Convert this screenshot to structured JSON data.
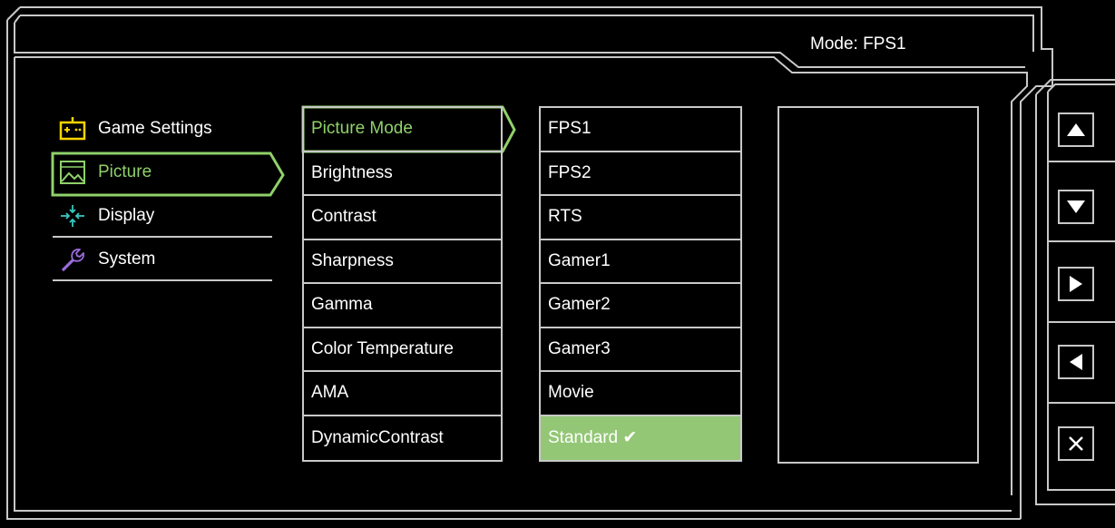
{
  "header": {
    "mode_text": "Mode: FPS1"
  },
  "main_menu": {
    "items": [
      {
        "label": "Game Settings",
        "icon": "gamepad-icon",
        "selected": false
      },
      {
        "label": "Picture",
        "icon": "picture-icon",
        "selected": true
      },
      {
        "label": "Display",
        "icon": "display-arrows-icon",
        "selected": false
      },
      {
        "label": "System",
        "icon": "wrench-icon",
        "selected": false
      }
    ]
  },
  "sub_menu": {
    "items": [
      {
        "label": "Picture Mode",
        "selected": true
      },
      {
        "label": "Brightness"
      },
      {
        "label": "Contrast"
      },
      {
        "label": "Sharpness"
      },
      {
        "label": "Gamma"
      },
      {
        "label": "Color Temperature"
      },
      {
        "label": "AMA"
      },
      {
        "label": "DynamicContrast"
      }
    ]
  },
  "options": {
    "items": [
      {
        "label": "FPS1"
      },
      {
        "label": "FPS2"
      },
      {
        "label": "RTS"
      },
      {
        "label": "Gamer1"
      },
      {
        "label": "Gamer2"
      },
      {
        "label": "Gamer3"
      },
      {
        "label": "Movie"
      },
      {
        "label": "Standard ✔",
        "selected": true
      }
    ]
  },
  "nav_buttons": [
    {
      "icon": "triangle-up-icon"
    },
    {
      "icon": "triangle-down-icon"
    },
    {
      "icon": "triangle-right-icon"
    },
    {
      "icon": "triangle-left-icon"
    },
    {
      "icon": "close-x-icon"
    }
  ],
  "colors": {
    "background": "#000000",
    "frame": "#c8c8c8",
    "accent_green": "#8fd16a",
    "selected_fill": "#93c775",
    "gamepad_yellow": "#ffd400",
    "display_teal": "#38c7c0",
    "wrench_purple": "#9b6be0"
  }
}
